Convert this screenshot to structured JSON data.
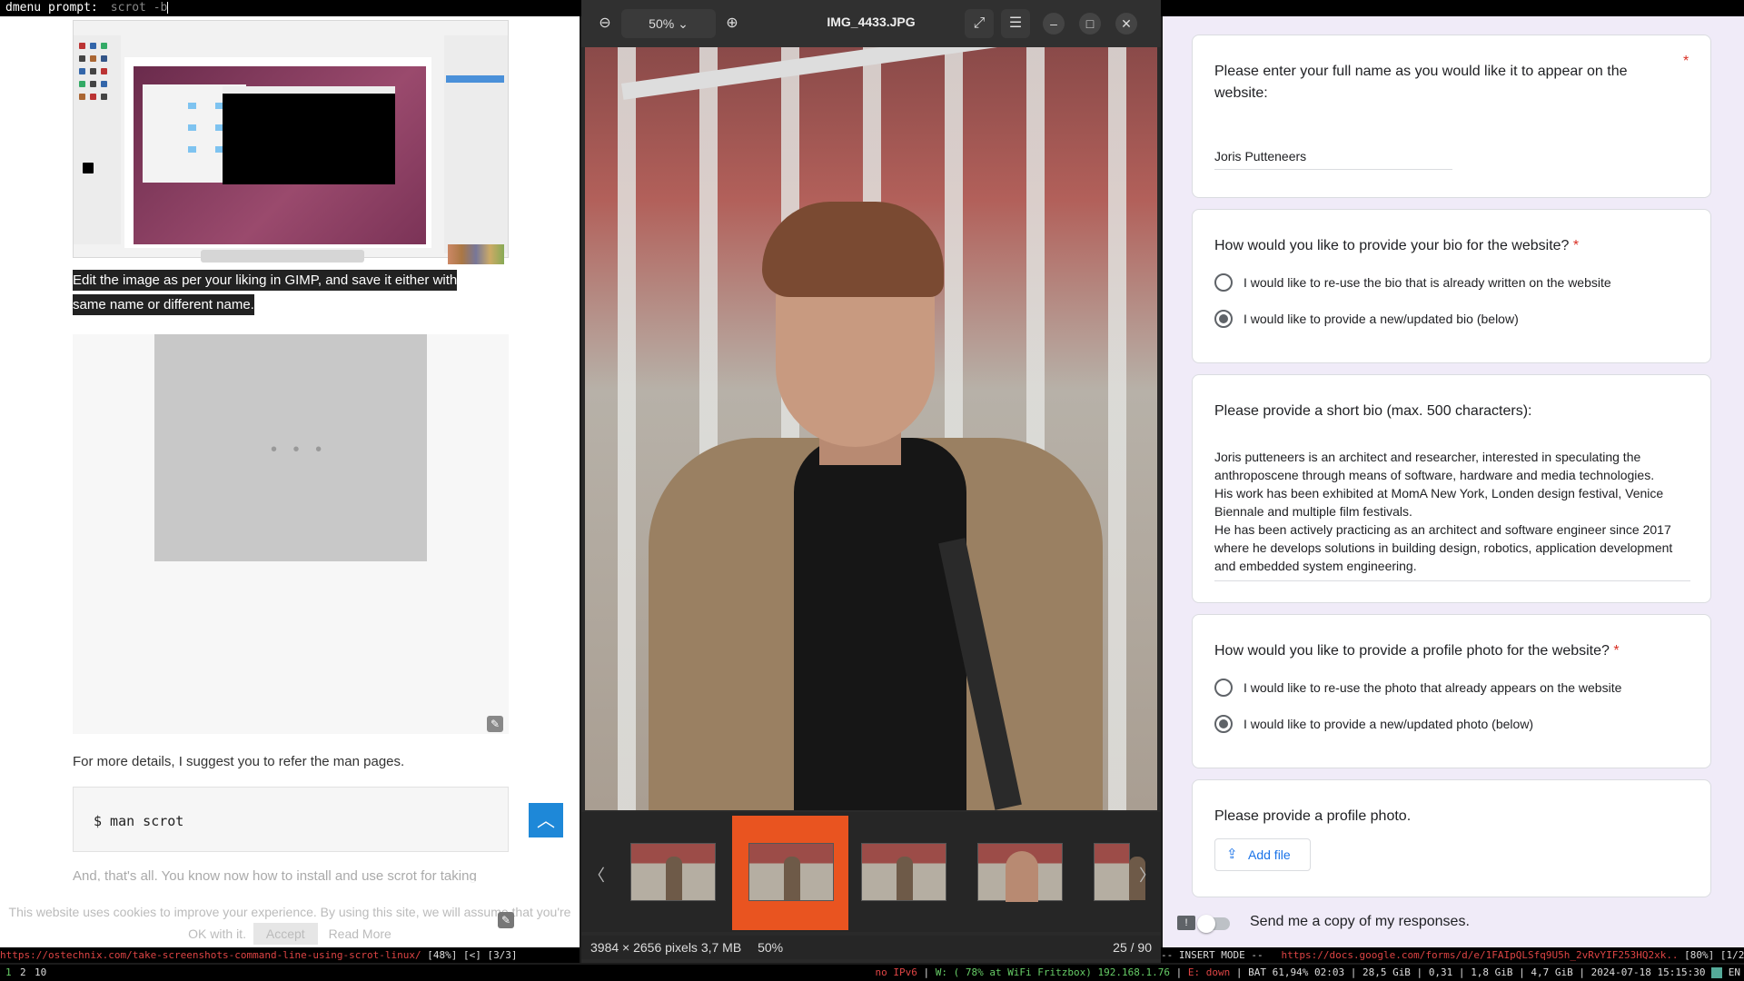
{
  "dmenu": {
    "prompt": "dmenu prompt:",
    "input": "scrot -b"
  },
  "article": {
    "caption": "Edit the image as per your liking in GIMP, and save it either with same name or different name.",
    "ad_dots": "• • •",
    "more_details": "For more details, I suggest you to refer the man pages.",
    "code": "$ man scrot",
    "faded_text": "And, that's all. You know now how to install and use scrot for taking",
    "cookie_text": "This website uses cookies to improve your experience. By using this site, we will assume that you're OK with it.",
    "cookie_accept": "Accept",
    "cookie_read_more": "Read More"
  },
  "viewer": {
    "zoom": "50%",
    "title": "IMG_4433.JPG",
    "dimensions": "3984 × 2656 pixels",
    "size": "3,7 MB",
    "zoom_status": "50%",
    "counter": "25 / 90",
    "icons": [
      "zoom-out-icon",
      "zoom-in-icon",
      "fullscreen-icon",
      "menu-icon",
      "minimize-icon",
      "maximize-icon",
      "close-icon"
    ]
  },
  "form": {
    "q1": "Please enter your full name as you would like it to appear on the website:",
    "q1_required": "*",
    "name_value": "Joris Putteneers",
    "q2": "How would you like to provide your bio for the website?",
    "q2_opt1": "I would like to re-use the bio that is already written on the website",
    "q2_opt2": "I would like to provide a new/updated bio (below)",
    "q3": "Please provide a short bio (max. 500 characters):",
    "bio": "Joris putteneers is an architect and researcher, interested in speculating the anthroposcene through means of software, hardware and media technologies.\nHis work has been exhibited at MomA New York, Londen design festival, Venice Biennale and multiple film festivals.\nHe has been actively practicing as an architect and software engineer since 2017 where he develops solutions in building design, robotics, application development and embedded system engineering.",
    "q4": "How would you like to provide a profile photo for the website?",
    "q4_opt1": "I would like to re-use the photo that already appears on the website",
    "q4_opt2": "I would like to provide a new/updated photo (below)",
    "q5": "Please provide a profile photo.",
    "add_file": "Add file",
    "send_copy": "Send me a copy of my responses.",
    "required_mark": "*"
  },
  "status_left": {
    "url": "https://ostechnix.com/take-screenshots-command-line-using-scrot-linux/",
    "pos": " [48%] [<] [3/3]"
  },
  "status_right": {
    "mode": "-- INSERT MODE --",
    "url": "https://docs.google.com/forms/d/e/1FAIpQLSfq9U5h_2vRvYIF253HQ2xk..",
    "pos": " [80%] [1/2]"
  },
  "i3bar": {
    "workspaces": [
      "1",
      "2",
      "10"
    ],
    "ipv6": "no IPv6",
    "wifi": "W: ( 78% at WiFi Fritzbox) 192.168.1.76",
    "eth": "E: down",
    "battery": "BAT 61,94% 02:03",
    "disk": "28,5 GiB",
    "load": "0,31",
    "mem1": "1,8 GiB",
    "mem2": "4,7 GiB",
    "datetime": "2024-07-18 15:15:30",
    "lang": "EN"
  }
}
